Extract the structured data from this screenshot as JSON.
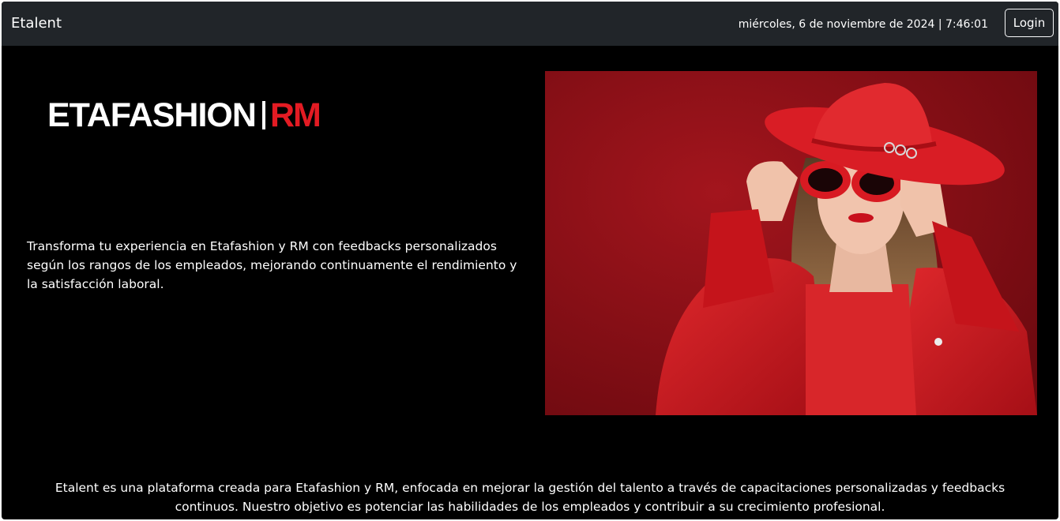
{
  "navbar": {
    "brand": "Etalent",
    "datetime": "miércoles, 6 de noviembre de 2024 | 7:46:01",
    "login_label": "Login"
  },
  "logo": {
    "part1": "ETAFASHION",
    "part2": "RM"
  },
  "intro_text": "Transforma tu experiencia en Etafashion y RM con feedbacks personalizados según los rangos de los empleados, mejorando continuamente el rendimiento y la satisfacción laboral.",
  "footer_text": "Etalent es una plataforma creada para Etafashion y RM, enfocada en mejorar la gestión del talento a través de capacitaciones personalizadas y feedbacks continuos. Nuestro objetivo es potenciar las habilidades de los empleados y contribuir a su crecimiento profesional.",
  "colors": {
    "navbar_bg": "#212529",
    "page_bg": "#000000",
    "brand_red": "#e31b23",
    "hero_bg": "#8e0f16"
  }
}
